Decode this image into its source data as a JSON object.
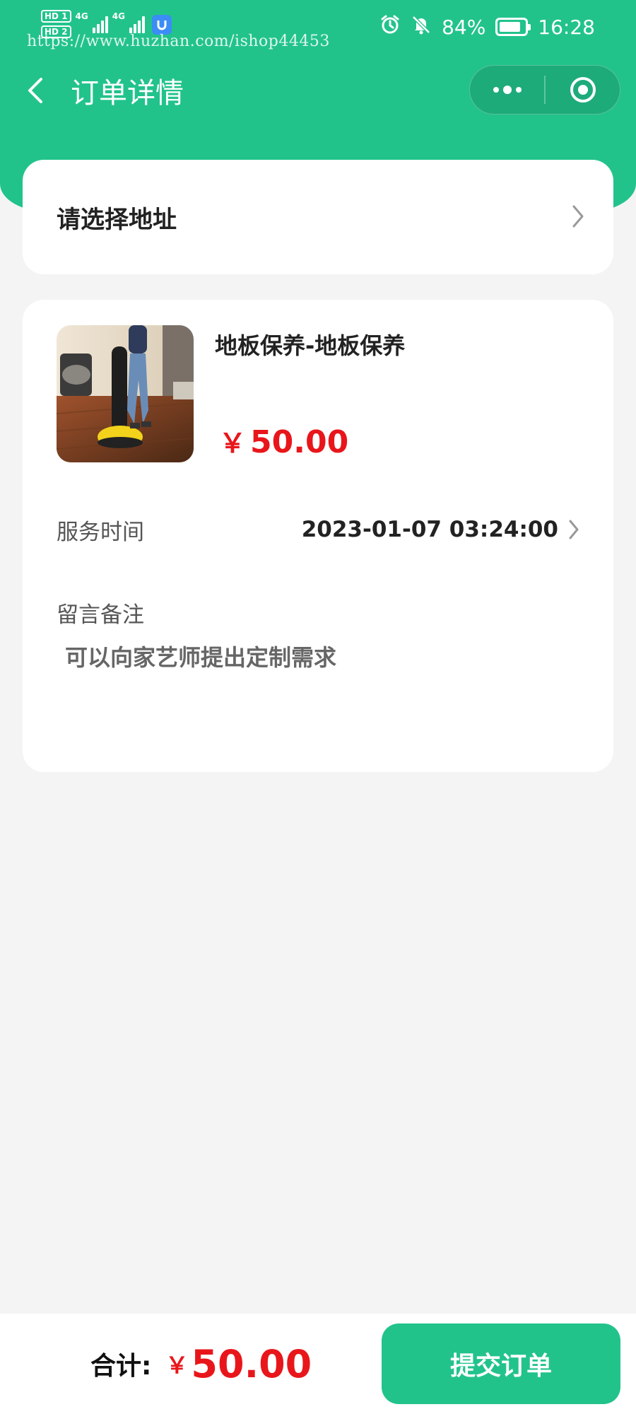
{
  "colors": {
    "primary": "#22c38b",
    "price_red": "#e8161b",
    "background": "#f4f4f4",
    "card": "#ffffff"
  },
  "status_bar": {
    "sim1": "HD 1",
    "sim2": "HD 2",
    "network1": "4G",
    "network2": "4G",
    "watermark": "https://www.huzhan.com/ishop44453",
    "battery_percent": "84%",
    "battery_level": 0.84,
    "time": "16:28",
    "icons": [
      "alarm-icon",
      "mute-bell-icon",
      "battery-icon"
    ]
  },
  "nav": {
    "title": "订单详情",
    "back_icon": "chevron-left-icon",
    "more_icon": "more-dots-icon",
    "close_icon": "target-circle-icon"
  },
  "address": {
    "placeholder": "请选择地址",
    "arrow_icon": "chevron-right-icon"
  },
  "order": {
    "product_name": "地板保养-地板保养",
    "currency": "￥",
    "price": "50.00",
    "service_time_label": "服务时间",
    "service_time_value": "2023-01-07 03:24:00",
    "remark_label": "留言备注",
    "remark_placeholder": "可以向家艺师提出定制需求"
  },
  "footer": {
    "total_label": "合计:",
    "currency": "￥",
    "total_amount": "50.00",
    "submit_label": "提交订单"
  }
}
